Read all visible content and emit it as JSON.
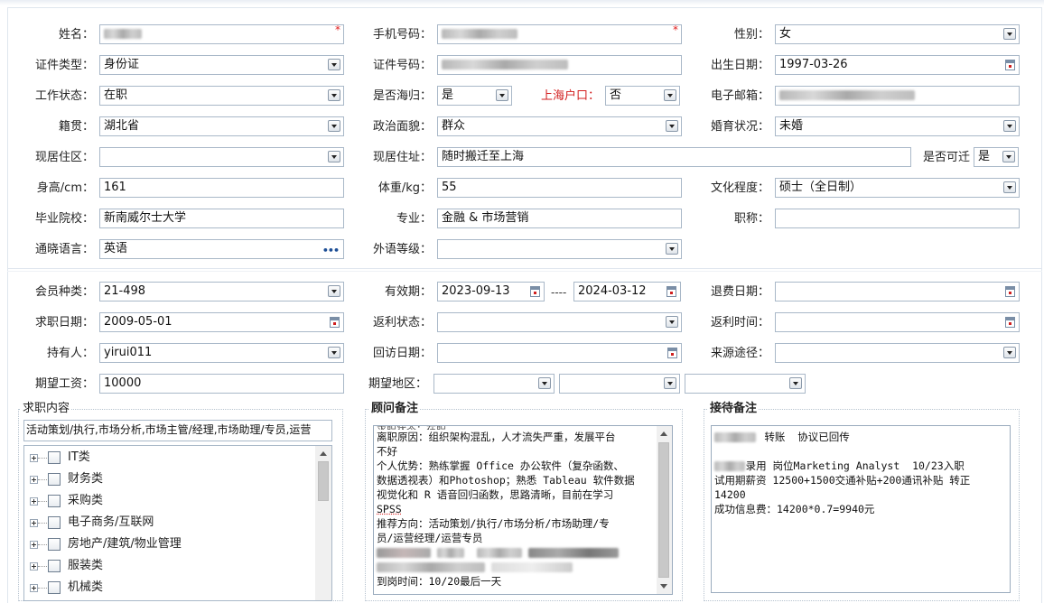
{
  "form": {
    "name_label": "姓名：",
    "phone_label": "手机号码：",
    "gender_label": "性别：",
    "gender_value": "女",
    "id_type_label": "证件类型：",
    "id_type_value": "身份证",
    "id_number_label": "证件号码：",
    "birth_label": "出生日期：",
    "birth_value": "1997-03-26",
    "work_status_label": "工作状态：",
    "work_status_value": "在职",
    "returnee_label": "是否海归：",
    "returnee_value": "是",
    "shanghai_hukou_label": "上海户口：",
    "shanghai_hukou_value": "否",
    "email_label": "电子邮箱：",
    "native_label": "籍贯：",
    "native_value": "湖北省",
    "political_label": "政治面貌：",
    "political_value": "群众",
    "marital_label": "婚育状况：",
    "marital_value": "未婚",
    "district_label": "现居住区：",
    "district_value": "",
    "address_label": "现居住址：",
    "address_value": "随时搬迁至上海",
    "relocate_label": "是否可迁",
    "relocate_value": "是",
    "height_label": "身高/cm：",
    "height_value": "161",
    "weight_label": "体重/kg：",
    "weight_value": "55",
    "education_label": "文化程度：",
    "education_value": "硕士（全日制）",
    "school_label": "毕业院校：",
    "school_value": "新南威尔士大学",
    "major_label": "专业：",
    "major_value": "金融 & 市场营销",
    "title_label": "职称：",
    "title_value": "",
    "language_label": "通晓语言：",
    "language_value": "英语",
    "language_more": "•••",
    "foreign_level_label": "外语等级：",
    "foreign_level_value": ""
  },
  "membership": {
    "member_type_label": "会员种类：",
    "member_type_value": "21-498",
    "valid_label": "有效期：",
    "valid_from": "2023-09-13",
    "valid_sep": "----",
    "valid_to": "2024-03-12",
    "refund_date_label": "退费日期：",
    "refund_date_value": "",
    "job_date_label": "求职日期：",
    "job_date_value": "2009-05-01",
    "rebate_status_label": "返利状态：",
    "rebate_status_value": "",
    "rebate_time_label": "返利时间：",
    "rebate_time_value": "",
    "holder_label": "持有人：",
    "holder_value": "yirui011",
    "visit_date_label": "回访日期：",
    "visit_date_value": "",
    "source_label": "来源途径：",
    "source_value": "",
    "salary_label": "期望工资：",
    "salary_value": "10000",
    "region_label": "期望地区："
  },
  "job_content": {
    "title": "求职内容",
    "summary": "活动策划/执行,市场分析,市场主管/经理,市场助理/专员,运营",
    "tree": [
      "IT类",
      "财务类",
      "采购类",
      "电子商务/互联网",
      "房地产/建筑/物业管理",
      "服装类",
      "机械类"
    ]
  },
  "consultant_notes": {
    "title": "顾问备注",
    "lines": [
      "离职原因：组织架构混乱，人才流失严重，发展平台",
      "不好",
      "个人优势：熟练掌握 Office 办公软件（复杂函数、",
      "数据透视表）和Photoshop；熟悉 Tableau 软件数据",
      "视觉化和 R 语音回归函数，思路清晰，目前在学习",
      "SPSS",
      "推荐方向：活动策划/执行/市场分析/市场助理/专",
      "员/运营经理/运营专员",
      "",
      "",
      "到岗时间：10/20最后一天"
    ]
  },
  "reception_notes": {
    "title": "接待备注",
    "lines": [
      "        转账  协议已回传",
      "",
      "     录用 岗位Marketing Analyst  10/23入职",
      "试用期薪资 12500+1500交通补贴+200通讯补贴 转正",
      "14200",
      "成功信息费：14200*0.7=9940元"
    ]
  },
  "icons": {
    "dropdown": "chevron-down-icon",
    "calendar": "calendar-icon",
    "more": "ellipsis-icon",
    "expand": "plus-icon",
    "checkbox": "checkbox-icon"
  },
  "colors": {
    "border": "#a9b8c8",
    "required": "#e02020",
    "hukou_label": "#d21e1e"
  }
}
